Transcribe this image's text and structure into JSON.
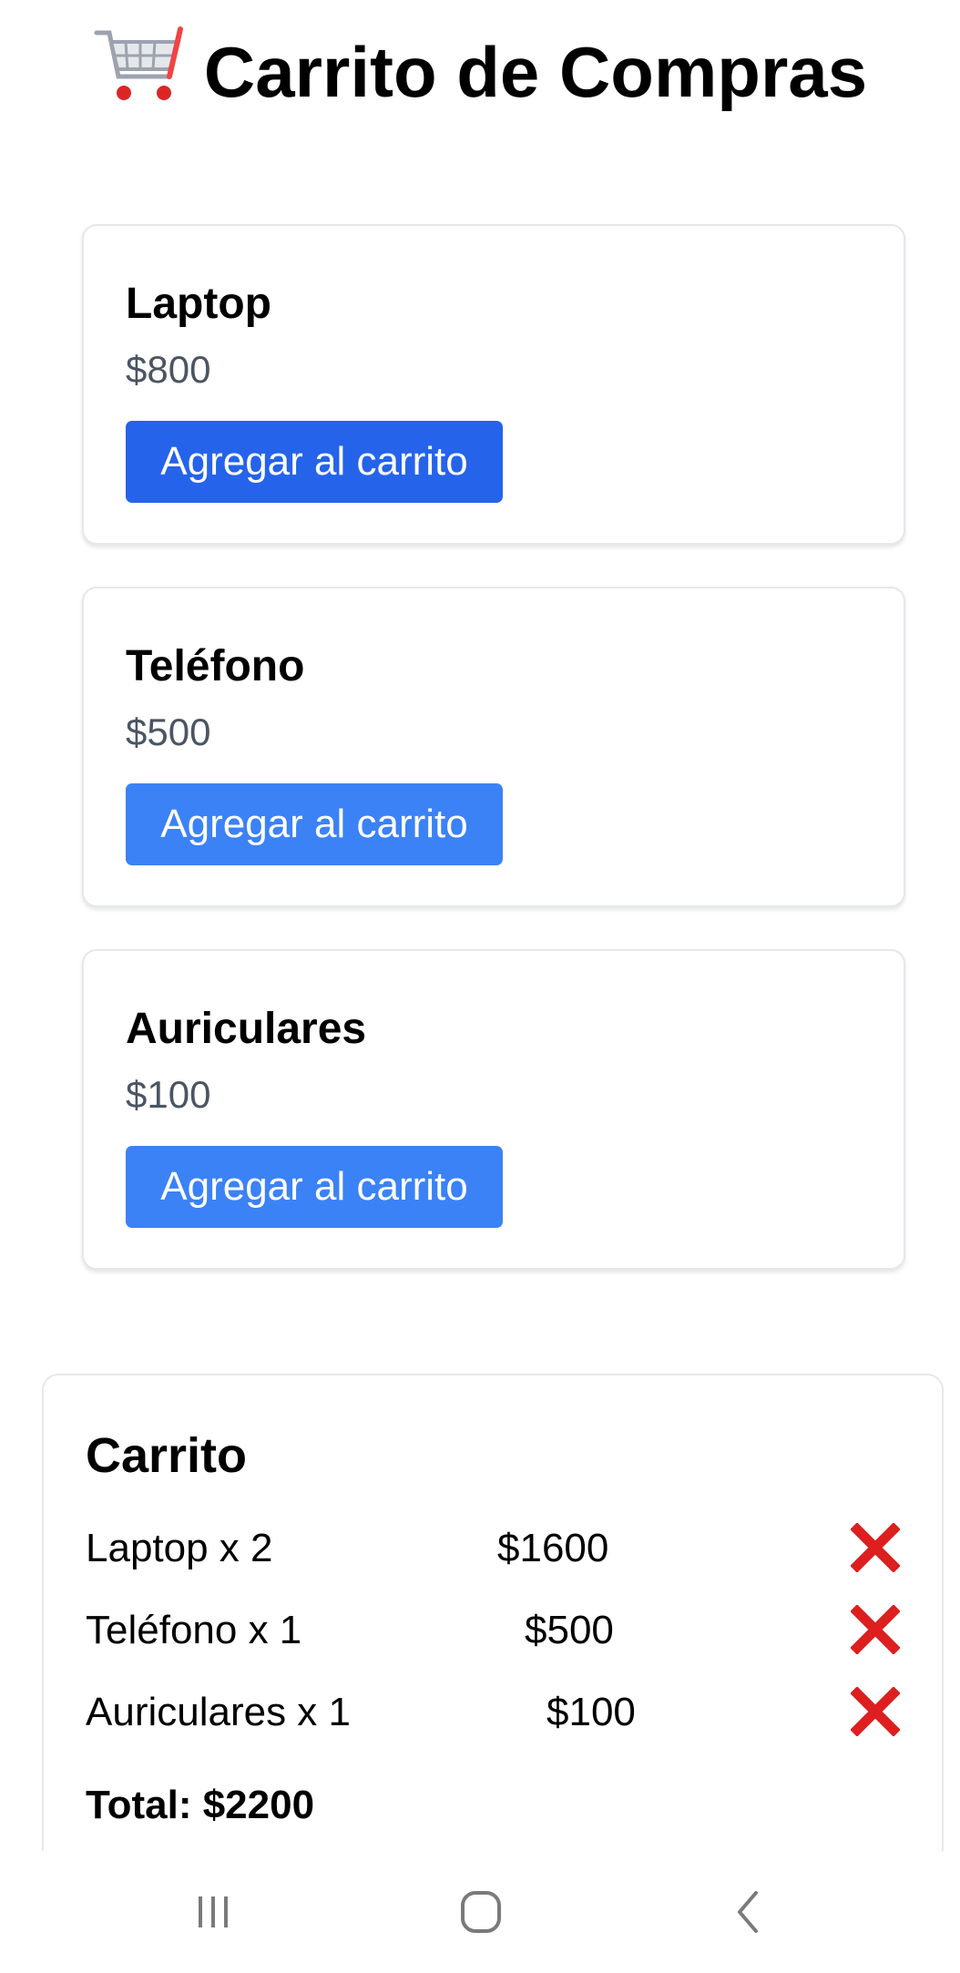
{
  "page": {
    "title": "Carrito de Compras",
    "title_icon": "shopping-cart-icon"
  },
  "products": [
    {
      "name": "Laptop",
      "price": "$800",
      "button_label": "Agregar al carrito",
      "button_color": "#2563eb"
    },
    {
      "name": "Teléfono",
      "price": "$500",
      "button_label": "Agregar al carrito",
      "button_color": "#3b82f6"
    },
    {
      "name": "Auriculares",
      "price": "$100",
      "button_label": "Agregar al carrito",
      "button_color": "#3b82f6"
    }
  ],
  "cart": {
    "title": "Carrito",
    "items": [
      {
        "label": "Laptop x 2",
        "price": "$1600",
        "remove_icon": "cross-mark-icon"
      },
      {
        "label": "Teléfono x 1",
        "price": "$500",
        "remove_icon": "cross-mark-icon"
      },
      {
        "label": "Auriculares x 1",
        "price": "$100",
        "remove_icon": "cross-mark-icon"
      }
    ],
    "total": "Total: $2200"
  },
  "navbar": {
    "icons": [
      "recent-apps-icon",
      "home-icon",
      "back-icon"
    ]
  },
  "colors": {
    "primary_button_active": "#2563eb",
    "primary_button": "#3b82f6",
    "remove_red": "#dd1f1f",
    "price_gray": "#4b5563"
  }
}
